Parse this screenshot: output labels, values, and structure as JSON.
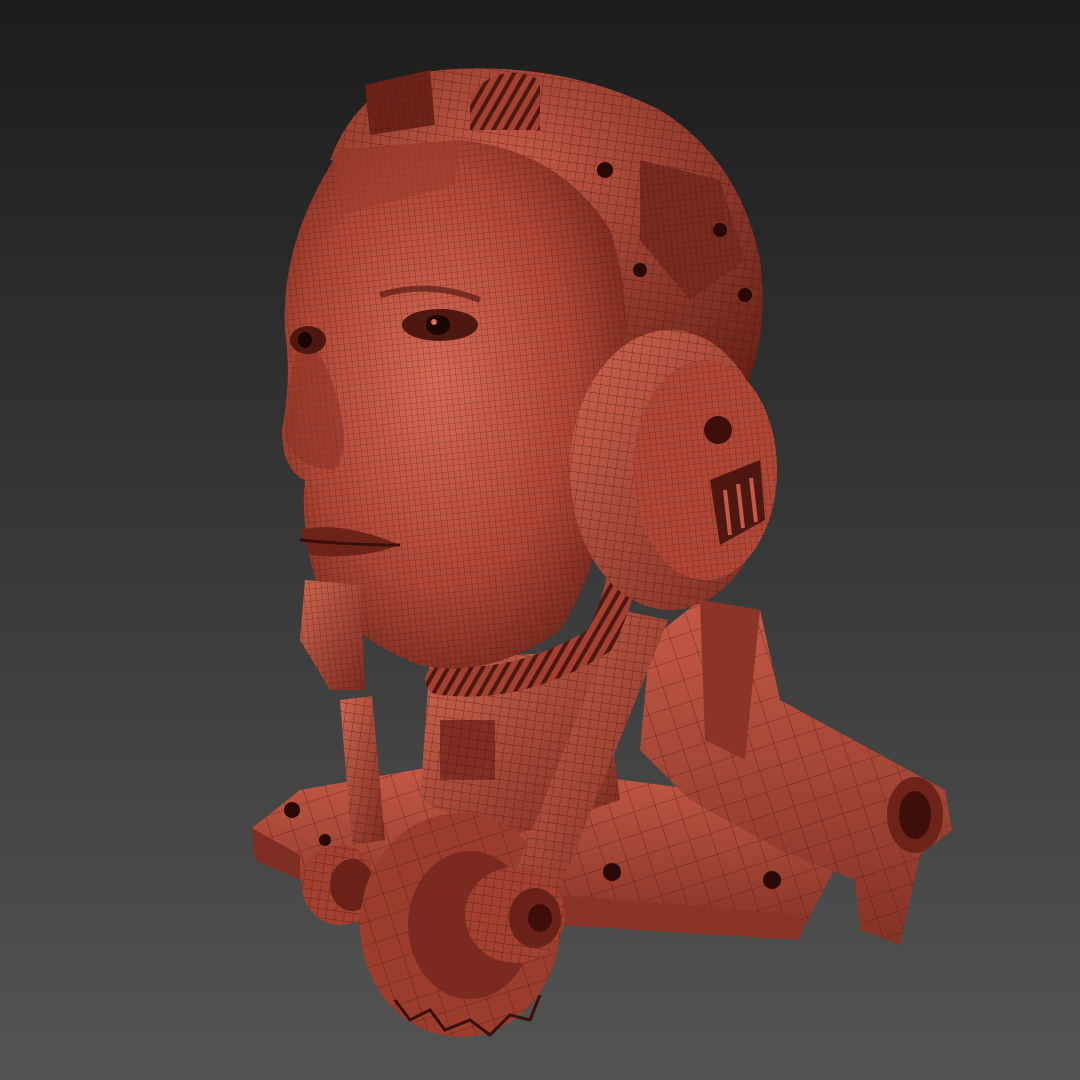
{
  "viewport": {
    "background_top": "#1c1c1c",
    "background_bottom": "#545454"
  },
  "model": {
    "subject": "cyborg-head-bust",
    "render_mode": "wireframe-over-shaded",
    "base_color": "#b24a3a",
    "highlight_color": "#d9705c",
    "shadow_color": "#5a1c15",
    "wire_color": "#3a100b"
  }
}
